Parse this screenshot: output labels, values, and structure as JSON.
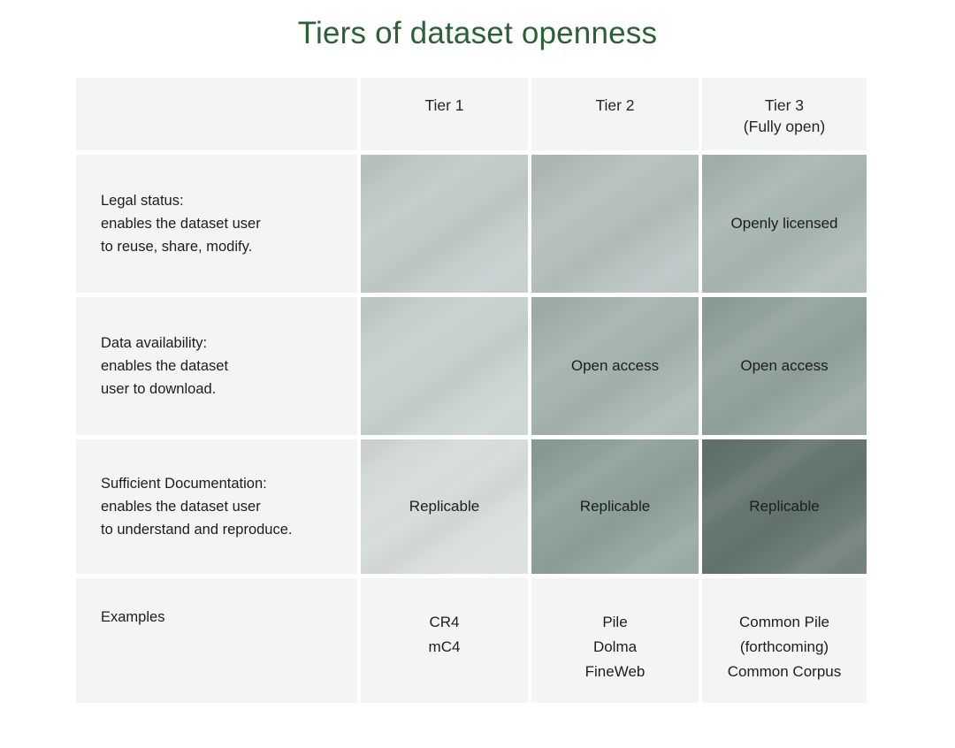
{
  "title": "Tiers of dataset openness",
  "title_color": "#2c6137",
  "page_background": "#ffffff",
  "neutral_cell_color": "#f4f4f4",
  "columns": [
    {
      "id": "criteria",
      "label": ""
    },
    {
      "id": "tier1",
      "label": "Tier 1"
    },
    {
      "id": "tier2",
      "label": "Tier 2"
    },
    {
      "id": "tier3",
      "label": "Tier 3\n(Fully open)"
    }
  ],
  "rows": [
    {
      "id": "legal-status",
      "label": "Legal status:\nenables the dataset user\nto reuse, share, modify.",
      "cells": [
        {
          "tier": "tier1",
          "text": "",
          "color": "#c3ccca"
        },
        {
          "tier": "tier2",
          "text": "",
          "color": "#b6c1bf"
        },
        {
          "tier": "tier3",
          "text": "Openly licensed",
          "color": "#aab8b3"
        }
      ]
    },
    {
      "id": "data-availability",
      "label": "Data availability:\nenables the dataset\nuser to download.",
      "cells": [
        {
          "tier": "tier1",
          "text": "",
          "color": "#c9d2cf"
        },
        {
          "tier": "tier2",
          "text": "Open access",
          "color": "#a6b5b0"
        },
        {
          "tier": "tier3",
          "text": "Open access",
          "color": "#93a49e"
        }
      ]
    },
    {
      "id": "sufficient-documentation",
      "label": "Sufficient Documentation:\nenables the dataset user\nto understand and reproduce.",
      "cells": [
        {
          "tier": "tier1",
          "text": "Replicable",
          "color": "#d8dedb"
        },
        {
          "tier": "tier2",
          "text": "Replicable",
          "color": "#8fa29b"
        },
        {
          "tier": "tier3",
          "text": "Replicable",
          "color": "#65776f"
        }
      ]
    },
    {
      "id": "examples",
      "label": "Examples",
      "cells": [
        {
          "tier": "tier1",
          "text": "CR4\nmC4",
          "color": "#f4f4f4"
        },
        {
          "tier": "tier2",
          "text": "Pile\nDolma\nFineWeb",
          "color": "#f4f4f4"
        },
        {
          "tier": "tier3",
          "text": "Common Pile\n(forthcoming)\nCommon Corpus",
          "color": "#f4f4f4"
        }
      ]
    }
  ]
}
